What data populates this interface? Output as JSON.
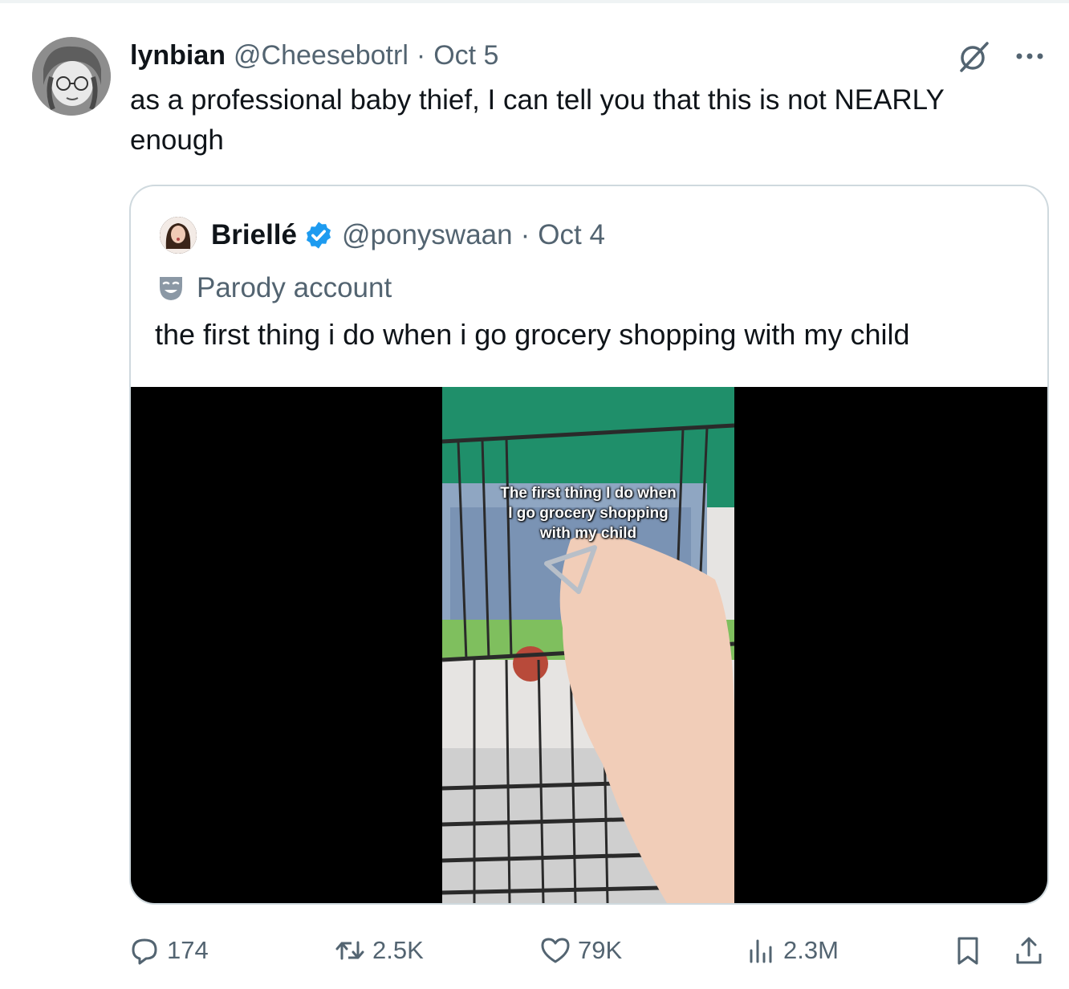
{
  "tweet": {
    "author_name": "lynbian",
    "handle": "@Cheesebotrl",
    "separator": "·",
    "date": "Oct 5",
    "text_line1": "as a professional baby thief, I can tell you that this is not NEARLY",
    "text_line2": "enough",
    "avatar_icon": "avatar-icon",
    "grok_icon": "grok-icon",
    "more_icon": "more-icon"
  },
  "quoted": {
    "author_name": "Briellé",
    "verified_icon": "verified-badge-icon",
    "handle": "@ponyswaan",
    "separator": "·",
    "date": "Oct 4",
    "label_icon": "parody-mask-icon",
    "label": "Parody account",
    "text": "the first thing i do when i go grocery shopping with my child",
    "media": {
      "caption_line1": "The first thing I do when",
      "caption_line2": "I go grocery shopping",
      "caption_line3": "with my child"
    }
  },
  "actions": {
    "replies": "174",
    "reposts": "2.5K",
    "likes": "79K",
    "views": "2.3M"
  },
  "colors": {
    "text": "#0f1419",
    "muted": "#536471",
    "border": "#cfd9de",
    "verified": "#1d9bf0"
  }
}
